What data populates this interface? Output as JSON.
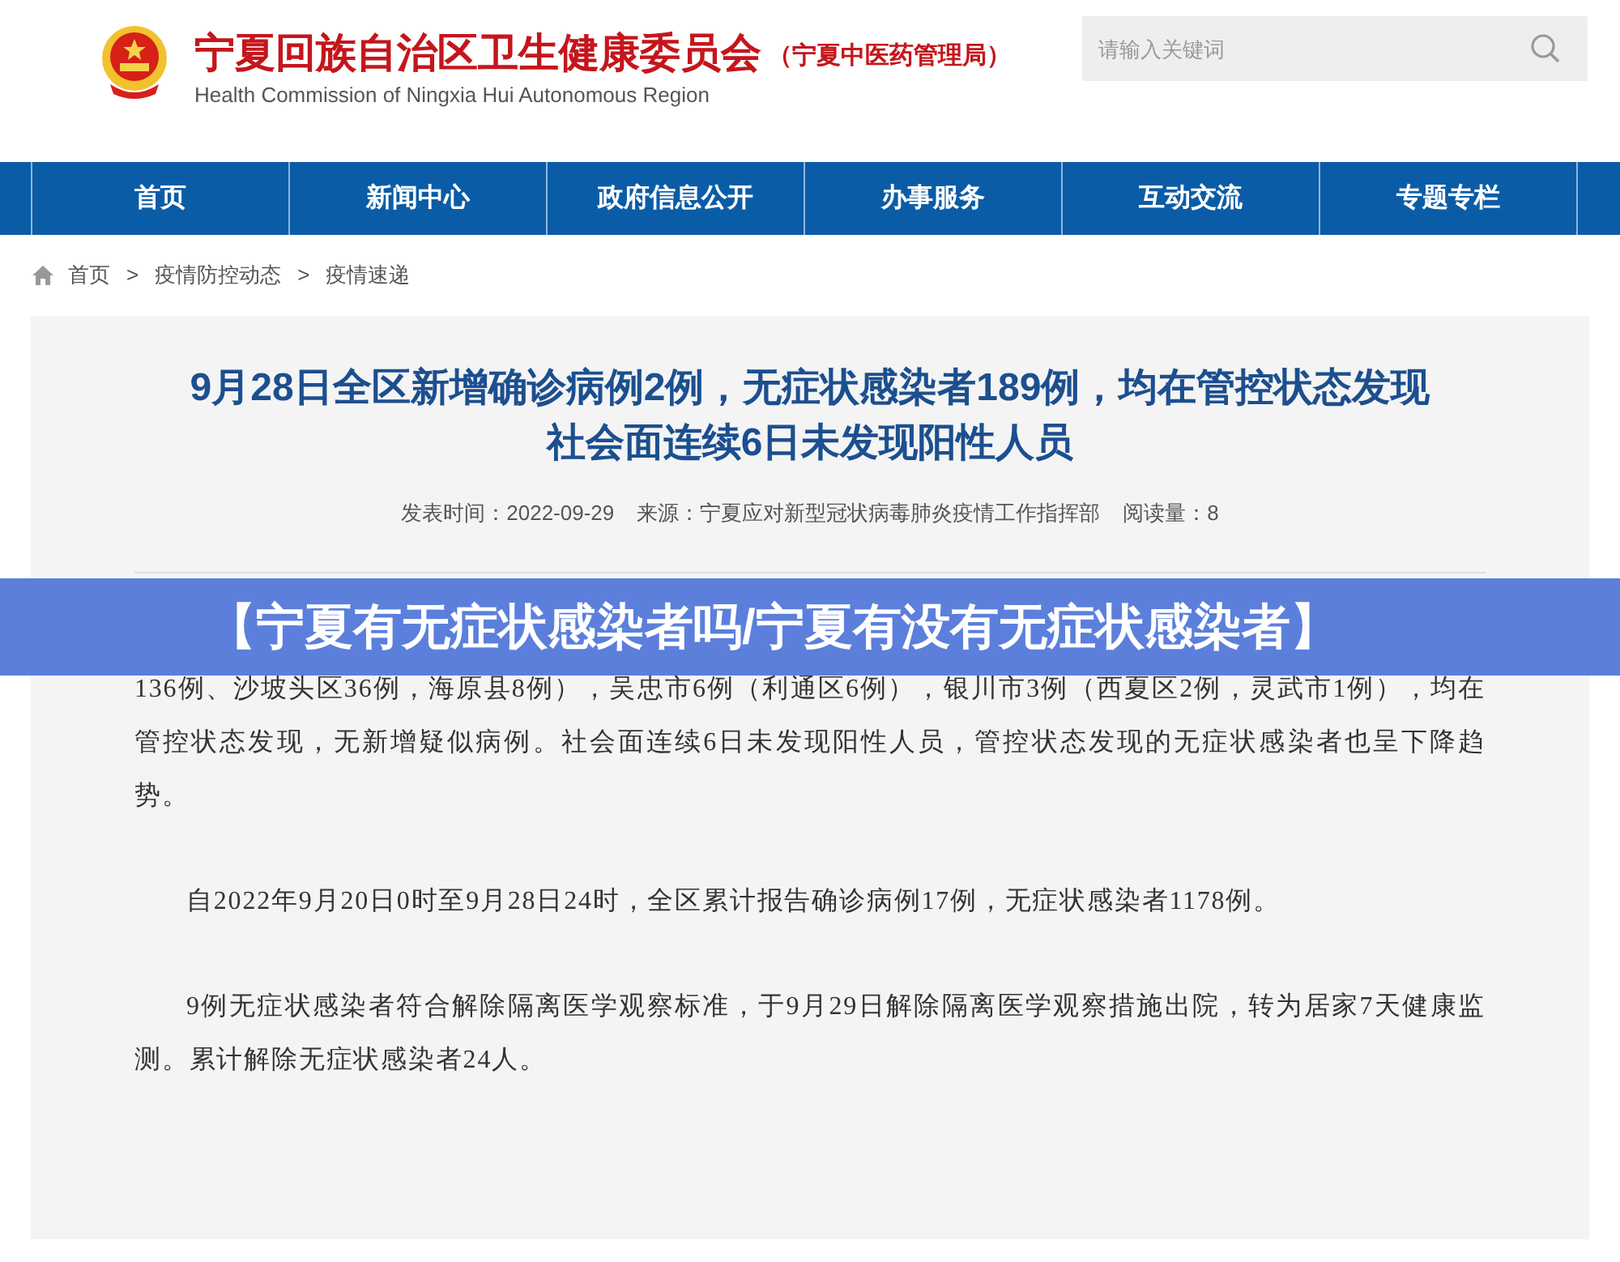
{
  "header": {
    "title": "宁夏回族自治区卫生健康委员会",
    "subtitle": "（宁夏中医药管理局）",
    "english": "Health Commission of Ningxia Hui Autonomous Region",
    "search": {
      "placeholder": "请输入关键词"
    }
  },
  "nav": [
    {
      "label": "首页"
    },
    {
      "label": "新闻中心"
    },
    {
      "label": "政府信息公开"
    },
    {
      "label": "办事服务"
    },
    {
      "label": "互动交流"
    },
    {
      "label": "专题专栏"
    }
  ],
  "breadcrumb": [
    "首页",
    "疫情防控动态",
    "疫情速递"
  ],
  "breadcrumb_separator": ">",
  "article": {
    "title_lines": [
      "9月28日全区新增确诊病例2例，无症状感染者189例，均在管控状态发现",
      "社会面连续6日未发现阳性人员"
    ],
    "meta": [
      "发表时间：2022-09-29",
      "来源：宁夏应对新型冠状病毒肺炎疫情工作指挥部",
      "阅读量：8"
    ],
    "paragraphs": [
      "136例、沙坡头区36例，海原县8例），吴忠市6例（利通区6例），银川市3例（西夏区2例，灵武市1例），均在管控状态发现，无新增疑似病例。社会面连续6日未发现阳性人员，管控状态发现的无症状感染者也呈下降趋势。",
      "自2022年9月20日0时至9月28日24时，全区累计报告确诊病例17例，无症状感染者1178例。",
      "9例无症状感染者符合解除隔离医学观察标准，于9月29日解除隔离医学观察措施出院，转为居家7天健康监测。累计解除无症状感染者24人。"
    ]
  },
  "banner": "【宁夏有无症状感染者吗/宁夏有没有无症状感染者】"
}
